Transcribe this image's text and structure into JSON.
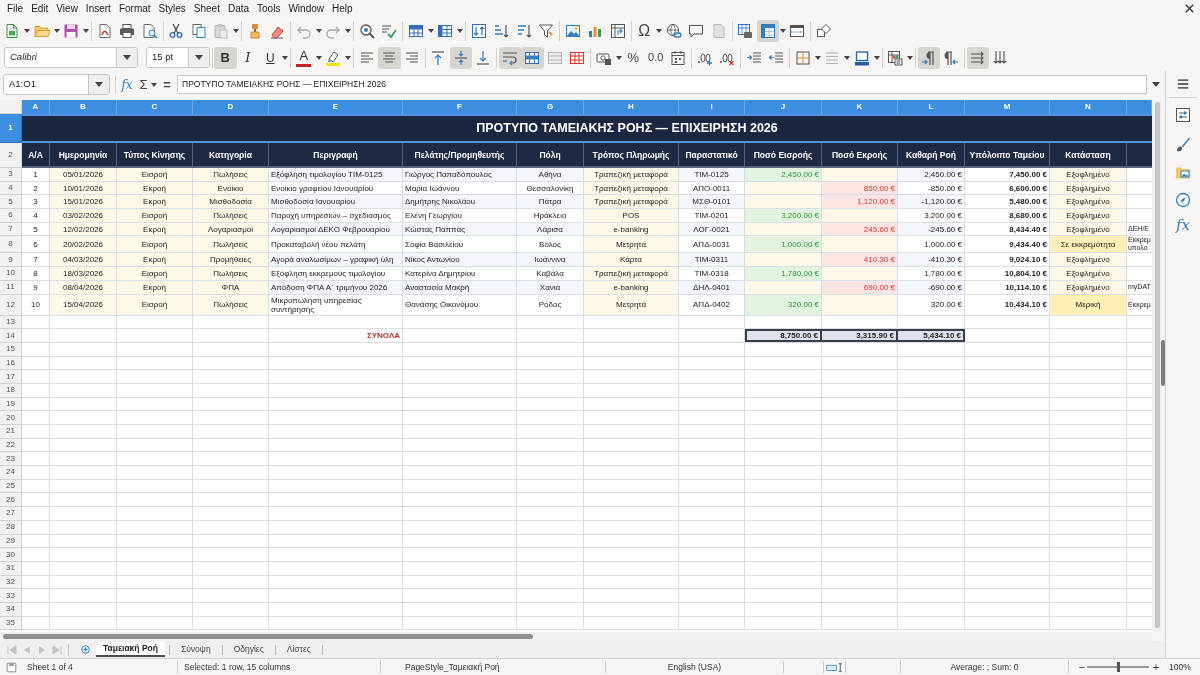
{
  "menu_bar": {
    "items": [
      "File",
      "Edit",
      "View",
      "Insert",
      "Format",
      "Styles",
      "Sheet",
      "Data",
      "Tools",
      "Window",
      "Help"
    ]
  },
  "standard_toolbar": {
    "special_character": "Ω",
    "freeze_rows_columns": {
      "pressed": true
    }
  },
  "formatting_toolbar": {
    "font_name": "Calibri",
    "font_size": "15 pt",
    "bold": {
      "label": "B",
      "pressed": true
    },
    "italic": {
      "label": "I",
      "pressed": false
    },
    "underline": {
      "label": "U",
      "pressed": false
    },
    "font_color": "A",
    "align_center": {
      "pressed": true
    },
    "align_middle": {
      "pressed": true
    },
    "wrap_text": {
      "pressed": true
    },
    "merge_and_center": {
      "pressed": true
    },
    "percent": "%",
    "number_format": "0.0",
    "left_to_right": {
      "pressed": true
    },
    "text_direction": {
      "pressed": true
    }
  },
  "formula_bar": {
    "name_box": "A1:O1",
    "function_wizard": "fx",
    "sum": "Σ",
    "equals": "=",
    "content": "ΠΡΟΤΥΠΟ ΤΑΜΕΙΑΚΗΣ ΡΟΗΣ — ΕΠΙΧΕΙΡΗΣΗ 2026"
  },
  "sidebar": {
    "functions": "fx"
  },
  "sheet": {
    "column_headers": [
      {
        "label": "A",
        "selected": true
      },
      {
        "label": "B",
        "selected": true
      },
      {
        "label": "C",
        "selected": true
      },
      {
        "label": "D",
        "selected": true
      },
      {
        "label": "E",
        "selected": true
      },
      {
        "label": "F",
        "selected": true
      },
      {
        "label": "G",
        "selected": true
      },
      {
        "label": "H",
        "selected": true
      },
      {
        "label": "I",
        "selected": true
      },
      {
        "label": "J",
        "selected": true
      },
      {
        "label": "K",
        "selected": true
      },
      {
        "label": "L",
        "selected": true
      },
      {
        "label": "M",
        "selected": true
      },
      {
        "label": "N",
        "selected": true
      },
      {
        "selected": true
      }
    ],
    "row_headers": [
      {
        "label": "1",
        "selected": true
      },
      {
        "label": "2",
        "selected": false
      },
      {
        "label": "3",
        "selected": false
      },
      {
        "label": "4",
        "selected": false
      },
      {
        "label": "5",
        "selected": false
      },
      {
        "label": "6",
        "selected": false
      },
      {
        "label": "7",
        "selected": false
      },
      {
        "label": "8",
        "selected": false
      },
      {
        "label": "9",
        "selected": false
      },
      {
        "label": "10",
        "selected": false
      },
      {
        "label": "11",
        "selected": false
      },
      {
        "label": "12",
        "selected": false
      },
      {
        "label": "13",
        "selected": false
      },
      {
        "label": "14",
        "selected": false
      },
      {
        "label": "15",
        "selected": false
      },
      {
        "label": "16",
        "selected": false
      },
      {
        "label": "17",
        "selected": false
      },
      {
        "label": "18",
        "selected": false
      },
      {
        "label": "19",
        "selected": false
      },
      {
        "label": "20",
        "selected": false
      },
      {
        "label": "21",
        "selected": false
      },
      {
        "label": "22",
        "selected": false
      },
      {
        "label": "23",
        "selected": false
      },
      {
        "label": "24",
        "selected": false
      },
      {
        "label": "25",
        "selected": false
      },
      {
        "label": "26",
        "selected": false
      },
      {
        "label": "27",
        "selected": false
      },
      {
        "label": "28",
        "selected": false
      },
      {
        "label": "29",
        "selected": false
      },
      {
        "label": "30",
        "selected": false
      },
      {
        "label": "31",
        "selected": false
      },
      {
        "label": "32",
        "selected": false
      },
      {
        "label": "33",
        "selected": false
      },
      {
        "label": "34",
        "selected": false
      },
      {
        "label": "35",
        "selected": false
      }
    ],
    "title": "ΠΡΟΤΥΠΟ ΤΑΜΕΙΑΚΗΣ ΡΟΗΣ — ΕΠΙΧΕΙΡΗΣΗ 2026",
    "header_row": [
      "Α/Α",
      "Ημερομηνία",
      "Τύπος Κίνησης",
      "Κατηγορία",
      "Περιγραφή",
      "Πελάτης/Προμηθευτής",
      "Πόλη",
      "Τρόπος Πληρωμής",
      "Παραστατικό",
      "Ποσό Εισροής",
      "Ποσό Εκροής",
      "Καθαρή Ροή",
      "Υπόλοιπο Ταμείου",
      "Κατάσταση"
    ],
    "rows": [
      {
        "no": "1",
        "date": "05/01/2026",
        "type": "Εισροή",
        "category": "Πωλήσεις",
        "description": "Εξόφληση τιμολογίου ΤΙΜ-0125",
        "party": "Γιώργος Παπαδόπουλος",
        "city": "Αθήνα",
        "payment": "Τραπεζική μεταφορά",
        "document": "ΤΙΜ-0125",
        "inflow": "2,450.00 €",
        "net": "2,450.00 €",
        "balance": "7,450.00 €",
        "status": {
          "text": "Εξοφλημένο",
          "highlighted": false
        }
      },
      {
        "no": "2",
        "date": "10/01/2026",
        "type": "Εκροή",
        "category": "Ενοίκιο",
        "description": "Ενοίκιο γραφείου Ιανουαρίου",
        "party": "Μαρία Ιωάννου",
        "city": "Θεσσαλονίκη",
        "payment": "Τραπεζική μεταφορά",
        "document": "ΑΠΟ-0011",
        "outflow": "850.00 €",
        "net": "-850.00 €",
        "balance": "6,600.00 €",
        "status": {
          "text": "Εξοφλημένο",
          "highlighted": false
        }
      },
      {
        "no": "3",
        "date": "15/01/2026",
        "type": "Εκροή",
        "category": "Μισθοδοσία",
        "description": "Μισθοδοσία Ιανουαρίου",
        "party": "Δημήτρης Νικολάου",
        "city": "Πάτρα",
        "payment": "Τραπεζική μεταφορά",
        "document": "ΜΣΘ-0101",
        "outflow": "1,120.00 €",
        "net": "-1,120.00 €",
        "balance": "5,480.00 €",
        "status": {
          "text": "Εξοφλημένο",
          "highlighted": false
        }
      },
      {
        "no": "4",
        "date": "03/02/2026",
        "type": "Εισροή",
        "category": "Πωλήσεις",
        "description": "Παροχή υπηρεσιών – σχεδιασμός",
        "party": "Ελένη Γεωργίου",
        "city": "Ηράκλειο",
        "payment": "POS",
        "document": "ΤΙΜ-0201",
        "inflow": "3,200.00 €",
        "net": "3,200.00 €",
        "balance": "8,680.00 €",
        "status": {
          "text": "Εξοφλημένο",
          "highlighted": false
        }
      },
      {
        "no": "5",
        "date": "12/02/2026",
        "type": "Εκροή",
        "category": "Λογαριασμοί",
        "description": "Λογαριασμοί ΔΕΚΟ Φεβρουαρίου",
        "party": "Κώστας Παππάς",
        "city": "Λάρισα",
        "payment": "e-banking",
        "document": "ΛΟΓ-0021",
        "outflow": "245.60 €",
        "net": "-245.60 €",
        "balance": "8,434.40 €",
        "status": {
          "text": "Εξοφλημένο",
          "highlighted": false
        },
        "note": "ΔΕΗ/Ε"
      },
      {
        "no": "6",
        "date": "20/02/2026",
        "type": "Εισροή",
        "category": "Πωλήσεις",
        "description": "Προκαταβολή νέου πελάτη",
        "party": "Σοφία Βασιλείου",
        "city": "Βόλος",
        "payment": "Μετρητά",
        "document": "ΑΠΔ-0031",
        "inflow": "1,000.00 €",
        "net": "1,000.00 €",
        "balance": "9,434.40 €",
        "status": {
          "text": "Σε εκκρεμότητα",
          "highlighted": true
        },
        "note": "Εκκρεμ υπολο"
      },
      {
        "no": "7",
        "date": "04/03/2026",
        "type": "Εκροή",
        "category": "Προμήθειες",
        "description": "Αγορά αναλωσίμων – γραφική ύλη",
        "party": "Νίκος Αντωνίου",
        "city": "Ιωάννινα",
        "payment": "Κάρτα",
        "document": "ΤΙΜ-0311",
        "outflow": "410.30 €",
        "net": "-410.30 €",
        "balance": "9,024.10 €",
        "status": {
          "text": "Εξοφλημένο",
          "highlighted": false
        }
      },
      {
        "no": "8",
        "date": "18/03/2026",
        "type": "Εισροή",
        "category": "Πωλήσεις",
        "description": "Εξόφληση εκκρεμούς τιμολογίου",
        "party": "Κατερίνα Δημητρίου",
        "city": "Καβάλα",
        "payment": "Τραπεζική μεταφορά",
        "document": "ΤΙΜ-0318",
        "inflow": "1,780.00 €",
        "net": "1,780.00 €",
        "balance": "10,804.10 €",
        "status": {
          "text": "Εξοφλημένο",
          "highlighted": false
        }
      },
      {
        "no": "9",
        "date": "08/04/2026",
        "type": "Εκροή",
        "category": "ΦΠΑ",
        "description": "Απόδοση ΦΠΑ Α΄ τριμήνου 2026",
        "party": "Αναστασία Μακρή",
        "city": "Χανιά",
        "payment": "e-banking",
        "document": "ΔΗΛ-0401",
        "outflow": "690.00 €",
        "net": "-690.00 €",
        "balance": "10,114.10 €",
        "status": {
          "text": "Εξοφλημένο",
          "highlighted": false
        },
        "note": "myDAT"
      },
      {
        "no": "10",
        "date": "15/04/2026",
        "type": "Εισροή",
        "category": "Πωλήσεις",
        "description": "Μικροπώληση υπηρεσίας συντήρησης",
        "party": "Θανάσης Οικονόμου",
        "city": "Ρόδος",
        "payment": "Μετρητά",
        "document": "ΑΠΔ-0402",
        "inflow": "320.00 €",
        "net": "320.00 €",
        "balance": "10,434.10 €",
        "status": {
          "text": "Μερική",
          "highlighted": true
        },
        "note": "Εκκρεμ"
      }
    ],
    "totals": {
      "label": "ΣΥΝΟΛΑ",
      "inflow": "8,750.00 €",
      "outflow": "3,315.90 €",
      "net": "5,434.10 €"
    }
  },
  "sheet_tabs": [
    {
      "label": "Ταμειακή Ροή",
      "selected": true
    },
    {
      "label": "Σύνοψη",
      "selected": false
    },
    {
      "label": "Οδηγίες",
      "selected": false
    },
    {
      "label": "Λίστες",
      "selected": false
    }
  ],
  "status_bar": {
    "sheet": "Sheet 1 of 4",
    "selection": "Selected: 1 row, 15 columns",
    "page_style": "PageStyle_Ταμειακή Ροή",
    "language": "English (USA)",
    "summary": "Average: ; Sum: 0",
    "zoom": {
      "minus": "−",
      "plus": "+",
      "level": 0.5,
      "percent": "100%"
    }
  }
}
